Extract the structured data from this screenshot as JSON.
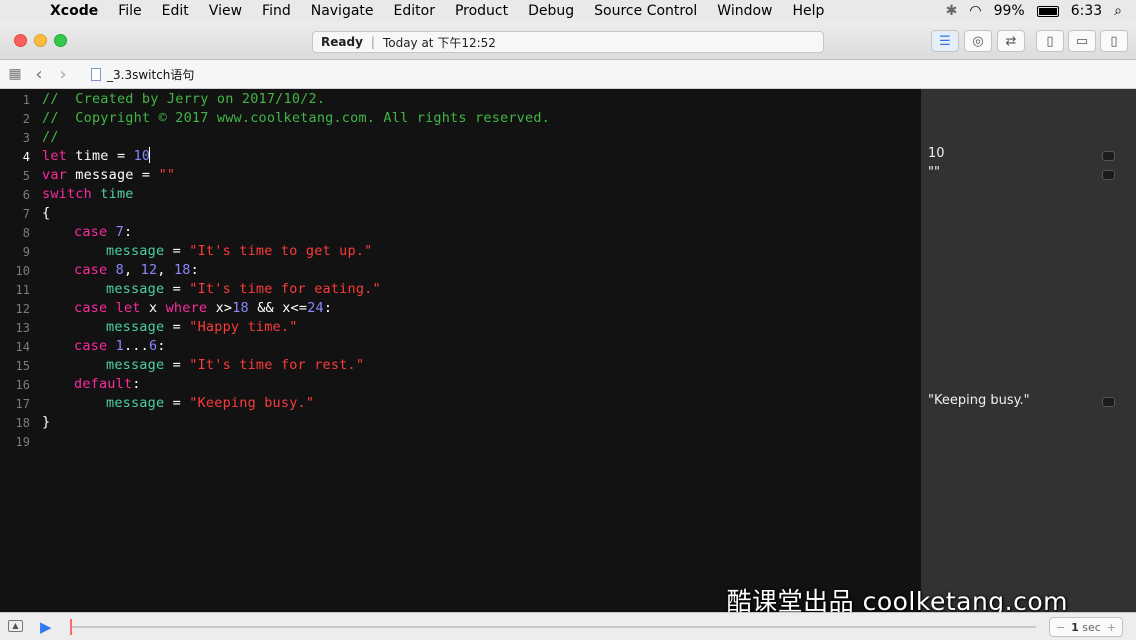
{
  "menubar": {
    "apple": "",
    "items": [
      "Xcode",
      "File",
      "Edit",
      "View",
      "Find",
      "Navigate",
      "Editor",
      "Product",
      "Debug",
      "Source Control",
      "Window",
      "Help"
    ],
    "status": {
      "bluetooth": "✱",
      "wifi": "◠",
      "battery": "99%",
      "time": "6:33",
      "search": "⌕"
    }
  },
  "window": {
    "status_label": "Ready",
    "status_sep": "|",
    "status_time": "Today at 下午12:52"
  },
  "jumpbar": {
    "grid": "▦",
    "back": "‹",
    "forward": "›",
    "file": "_3.3switch语句"
  },
  "editor": {
    "current_line": 4,
    "lines": [
      {
        "n": "1"
      },
      {
        "n": "2"
      },
      {
        "n": "3"
      },
      {
        "n": "4"
      },
      {
        "n": "5"
      },
      {
        "n": "6"
      },
      {
        "n": "7"
      },
      {
        "n": "8"
      },
      {
        "n": "9"
      },
      {
        "n": "10"
      },
      {
        "n": "11"
      },
      {
        "n": "12"
      },
      {
        "n": "13"
      },
      {
        "n": "14"
      },
      {
        "n": "15"
      },
      {
        "n": "16"
      },
      {
        "n": "17"
      },
      {
        "n": "18"
      },
      {
        "n": "19"
      }
    ],
    "t": {
      "l1": "//  Created by Jerry on 2017/10/2.",
      "l2": "//  Copyright © 2017 www.coolketang.com. All rights reserved.",
      "l3": "//",
      "let": "let",
      "time_a": " time = ",
      "ten": "10",
      "var": "var",
      "msg_a": " message = ",
      "empty": "\"\"",
      "switch": "switch",
      "time_b": " time",
      "ob": "{",
      "cb": "}",
      "case": "case",
      "c7": "7",
      "colon": ":",
      "message": "message",
      "eq": " = ",
      "s9": "\"It's time to get up.\"",
      "c8": "8",
      "comma": ", ",
      "c12": "12",
      "c18": "18",
      "s11": "\"It's time for eating.\"",
      "let2": "let",
      "x_sp": " x ",
      "where": "where",
      "xgt": " x>",
      "n18": "18",
      "andand": " && x<=",
      "n24": "24",
      "s13": "\"Happy time.\"",
      "n1": "1",
      "dots": "...",
      "n6": "6",
      "s15": "\"It's time for rest.\"",
      "default": "default",
      "s17": "\"Keeping busy.\""
    }
  },
  "results": {
    "r4": "10",
    "r5": "\"\"",
    "r17": "\"Keeping busy.\""
  },
  "watermark": "酷课堂出品 coolketang.com",
  "bottombar": {
    "run": "▶",
    "step_minus": "−",
    "step_value": "1",
    "step_unit": "sec",
    "step_plus": "+"
  }
}
